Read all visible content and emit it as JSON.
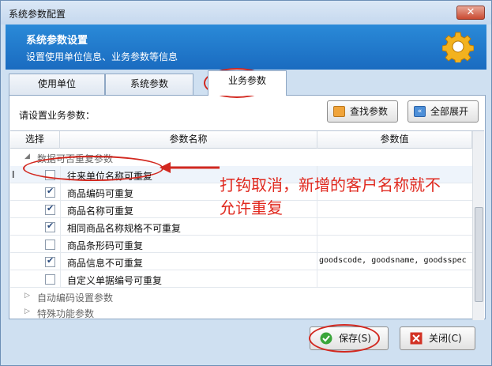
{
  "window": {
    "title": "系统参数配置",
    "close_glyph": "✕"
  },
  "header": {
    "title": "系统参数设置",
    "subtitle": "设置使用单位信息、业务参数等信息"
  },
  "tabs": [
    {
      "label": "使用单位",
      "active": false
    },
    {
      "label": "系统参数",
      "active": false
    },
    {
      "label": "业务参数",
      "active": true
    }
  ],
  "panel": {
    "prompt": "请设置业务参数：",
    "find_button": "查找参数",
    "expand_button": "全部展开"
  },
  "grid": {
    "columns": [
      "选择",
      "参数名称",
      "参数值"
    ],
    "groups": [
      {
        "name": "数据可否重复参数",
        "expanded": true
      },
      {
        "name": "自动编码设置参数",
        "expanded": false
      },
      {
        "name": "特殊功能参数",
        "expanded": false
      }
    ],
    "rows": [
      {
        "name": "往来单位名称可重复",
        "checked": false,
        "value": ""
      },
      {
        "name": "商品编码可重复",
        "checked": true,
        "value": ""
      },
      {
        "name": "商品名称可重复",
        "checked": true,
        "value": ""
      },
      {
        "name": "相同商品名称规格不可重复",
        "checked": true,
        "value": ""
      },
      {
        "name": "商品条形码可重复",
        "checked": false,
        "value": ""
      },
      {
        "name": "商品信息不可重复",
        "checked": true,
        "value": "goodscode, goodsname, goodsspec"
      },
      {
        "name": "自定义单据编号可重复",
        "checked": false,
        "value": ""
      }
    ],
    "row_marker": "I"
  },
  "annotation": {
    "line1": "打钩取消，新增的客户名称就不",
    "line2": "允许重复"
  },
  "footer": {
    "save_button": "保存(S)",
    "close_button": "关闭(C)"
  },
  "colors": {
    "header_blue": "#1f7bcd",
    "annotation_red": "#e0291f"
  }
}
